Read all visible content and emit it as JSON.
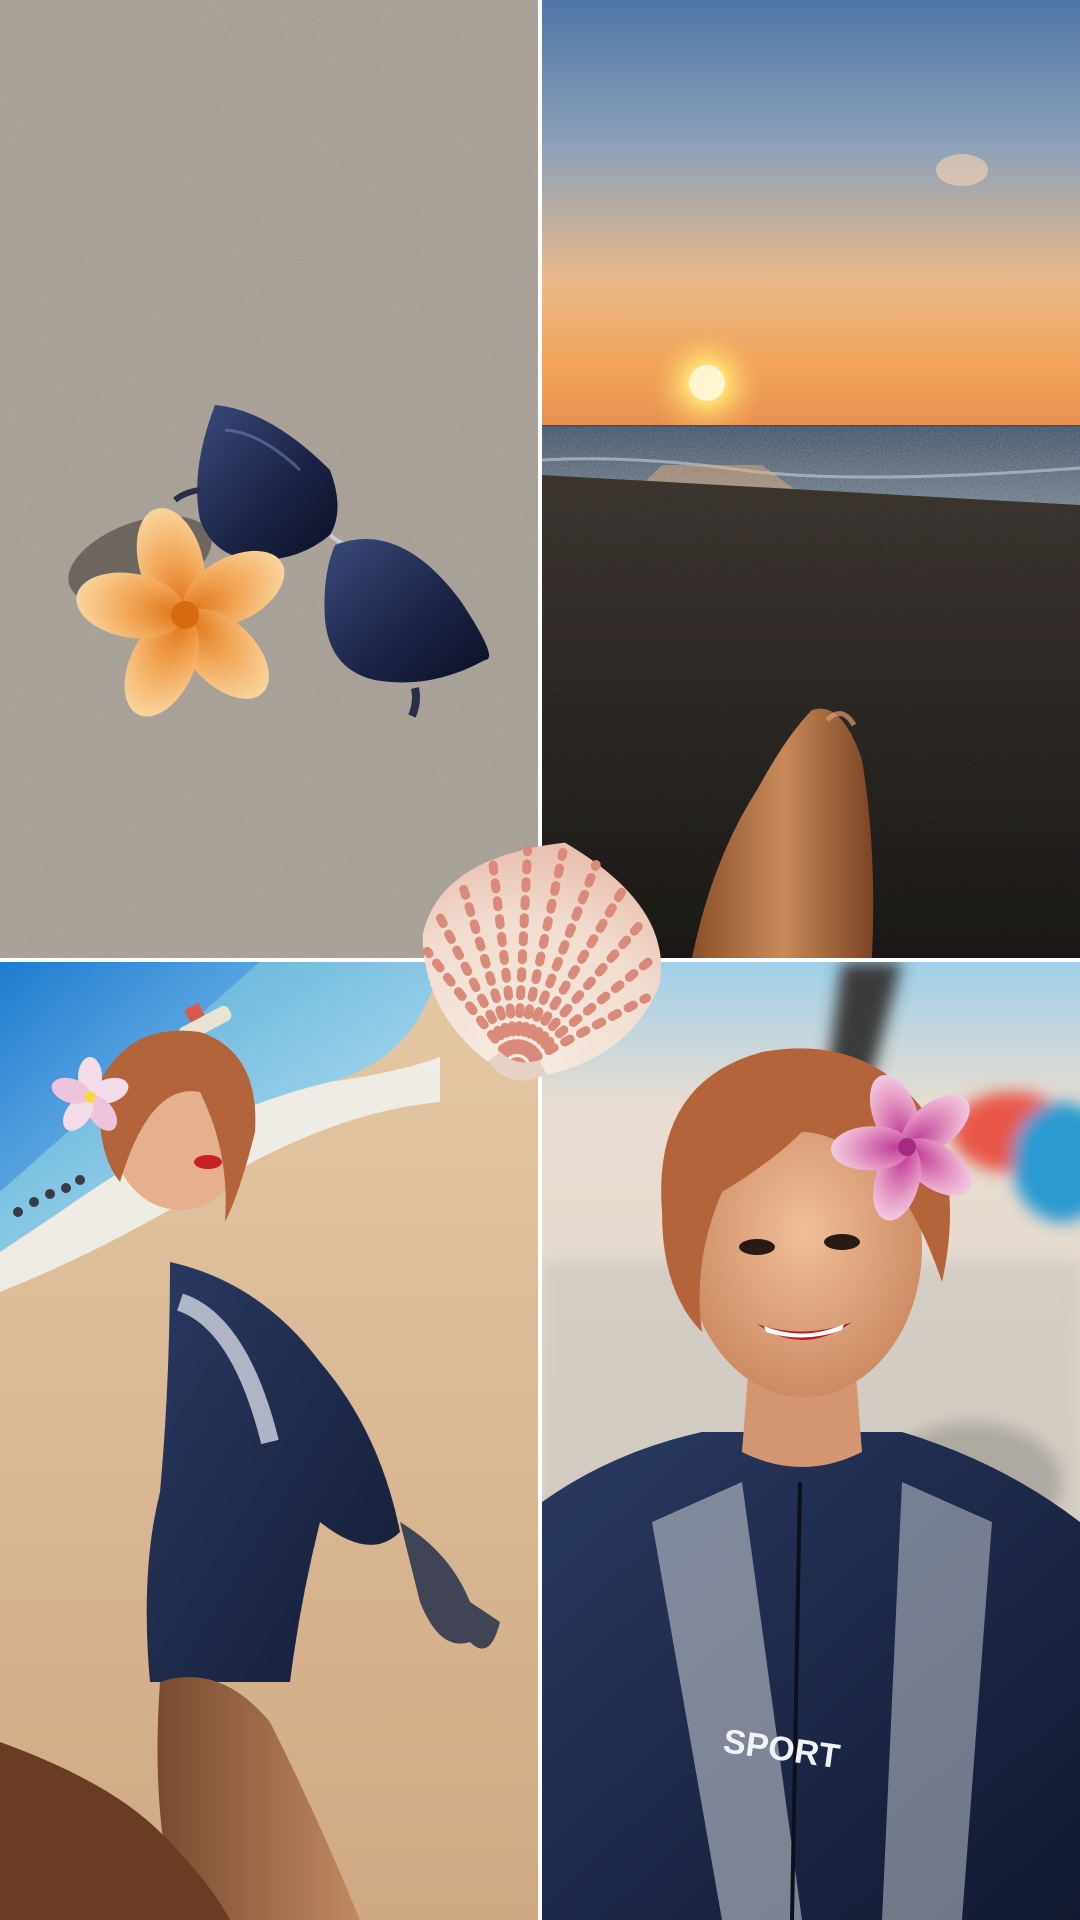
{
  "collage": {
    "tiles": [
      {
        "scene": "sunglasses-and-flower-on-sand"
      },
      {
        "scene": "sunset-over-sea-with-legs"
      },
      {
        "scene": "wide-angle-selfie-on-beach"
      },
      {
        "scene": "close-up-selfie-with-flower"
      }
    ],
    "sticker": {
      "scene": "scallop-shell"
    },
    "shirt_text": "SPORT",
    "colors": {
      "sand_light": "#b4aca2",
      "sand_dark": "#2b2722",
      "sunset_sky_top": "#5a7fb0",
      "sunset_glow": "#f0a45a",
      "sea_blue": "#4aa8d6",
      "wetsuit_navy": "#1d2a4a",
      "hair_auburn": "#b4643a",
      "flower_orange": "#f2a04a",
      "flower_pink": "#e8a0c8",
      "shell_coral": "#d98a7a"
    }
  }
}
